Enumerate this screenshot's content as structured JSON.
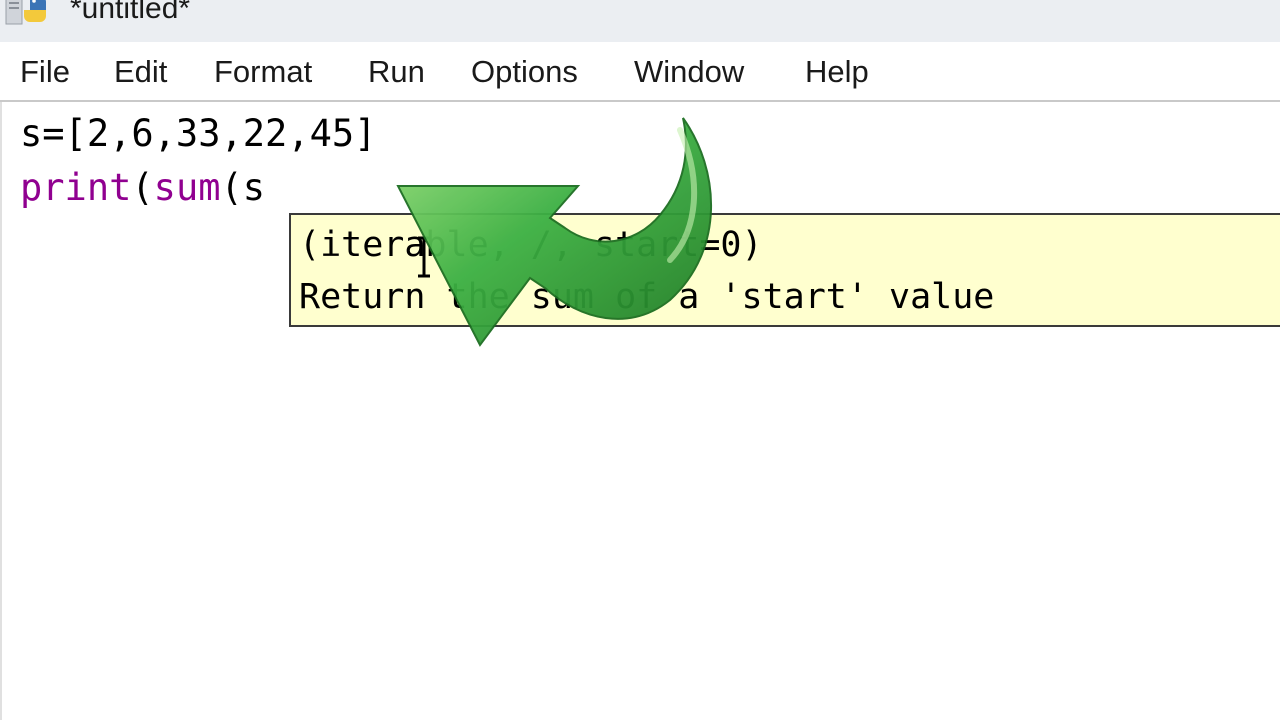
{
  "window": {
    "title": "*untitled*",
    "app_icon": "python-icon"
  },
  "menu": {
    "items": [
      {
        "label": "File",
        "name": "menu-file"
      },
      {
        "label": "Edit",
        "name": "menu-edit"
      },
      {
        "label": "Format",
        "name": "menu-format"
      },
      {
        "label": "Run",
        "name": "menu-run"
      },
      {
        "label": "Options",
        "name": "menu-options"
      },
      {
        "label": "Window",
        "name": "menu-window"
      },
      {
        "label": "Help",
        "name": "menu-help"
      }
    ]
  },
  "editor": {
    "line1": "s=[2,6,33,22,45]",
    "line2_builtin_print": "print",
    "line2_paren1": "(",
    "line2_builtin_sum": "sum",
    "line2_rest": "(s",
    "builtin_color": "#900090"
  },
  "calltip": {
    "signature": "(iterable, /, start=0)",
    "doc": "Return the sum of a 'start' value",
    "background": "#ffffcf"
  },
  "overlay": {
    "arrow_icon": "curved-arrow-icon",
    "arrow_color": "#3cb043"
  }
}
